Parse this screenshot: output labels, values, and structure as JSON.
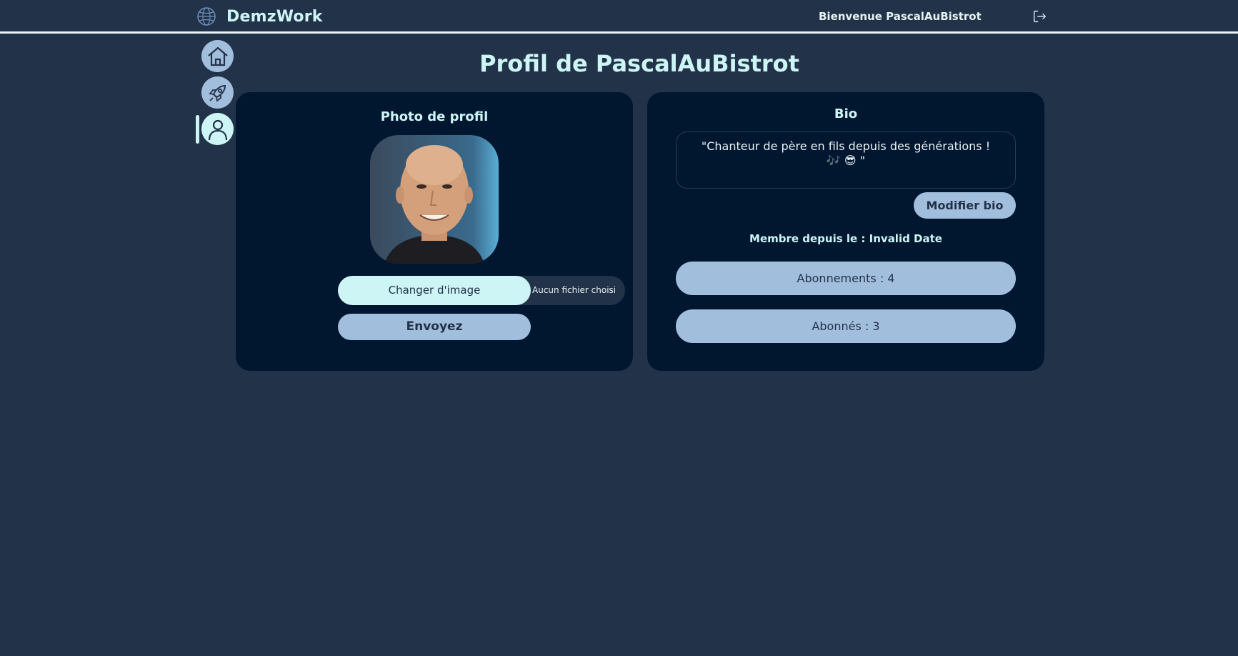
{
  "header": {
    "brand": "DemzWork",
    "welcome": "Bienvenue PascalAuBistrot"
  },
  "sidebar": {
    "items": [
      {
        "icon": "home-icon"
      },
      {
        "icon": "rocket-icon"
      },
      {
        "icon": "user-icon",
        "active": true
      }
    ]
  },
  "page": {
    "title": "Profil de PascalAuBistrot"
  },
  "photo_card": {
    "heading": "Photo de profil",
    "change_label": "Changer d'image",
    "file_status": "Aucun fichier choisi",
    "send_label": "Envoyez"
  },
  "bio_card": {
    "heading": "Bio",
    "bio_text": "\"Chanteur de père en fils depuis des générations ! 🎶 😎 \"",
    "edit_label": "Modifier bio",
    "member_since": "Membre depuis le : Invalid Date",
    "subscriptions": "Abonnements : 4",
    "followers": "Abonnés : 3"
  },
  "colors": {
    "background": "#223249",
    "card": "#011730",
    "accent": "#cdf5f5",
    "button": "#a2bedd"
  }
}
